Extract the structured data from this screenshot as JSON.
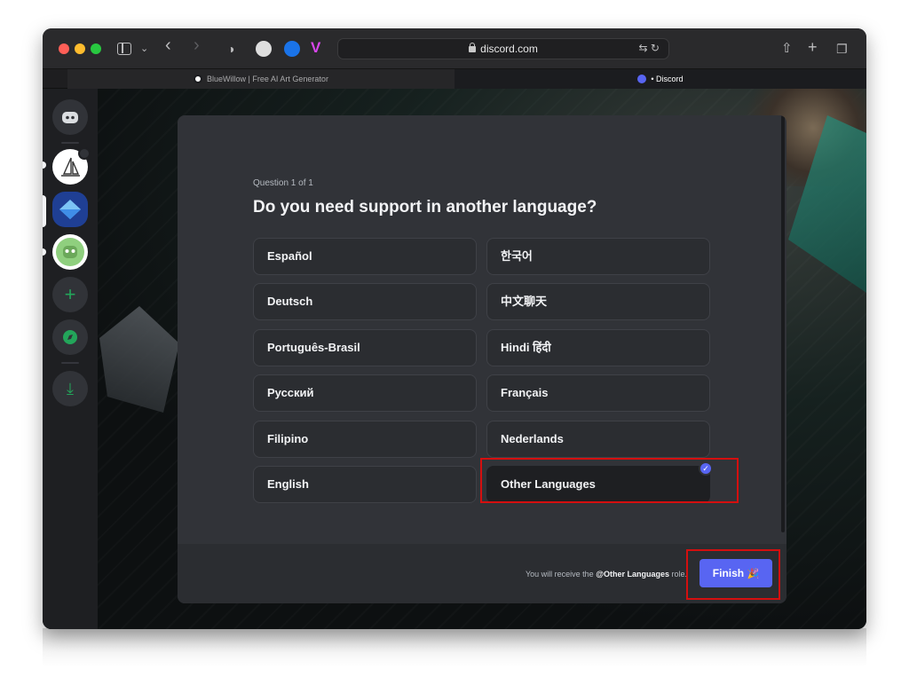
{
  "browser": {
    "address": "discord.com",
    "tabs": [
      {
        "label": "BlueWillow | Free AI Art Generator"
      },
      {
        "label": "• Discord"
      }
    ]
  },
  "onboarding": {
    "question_count": "Question 1 of 1",
    "question_title": "Do you need support in another language?",
    "options_left": [
      "Español",
      "Deutsch",
      "Português-Brasil",
      "Русский",
      "Filipino",
      "English"
    ],
    "options_right": [
      "한국어",
      "中文聊天",
      "Hindi हिंदी",
      "Français",
      "Nederlands",
      "Other Languages"
    ],
    "selected_option": "Other Languages",
    "footer_prefix": "You will receive the ",
    "footer_role": "@Other Languages",
    "footer_suffix": " role.",
    "finish_label": "Finish",
    "check_glyph": "✓"
  },
  "icons": {
    "tab_favicon_1": "bluewillow-icon",
    "tab_favicon_2": "discord-icon",
    "finish_emoji": "party-popper-icon",
    "finish_emoji_glyph": "🎉"
  },
  "colors": {
    "blurple": "#5865f2",
    "highlight": "#d40f0f",
    "modal_bg": "#313338"
  }
}
